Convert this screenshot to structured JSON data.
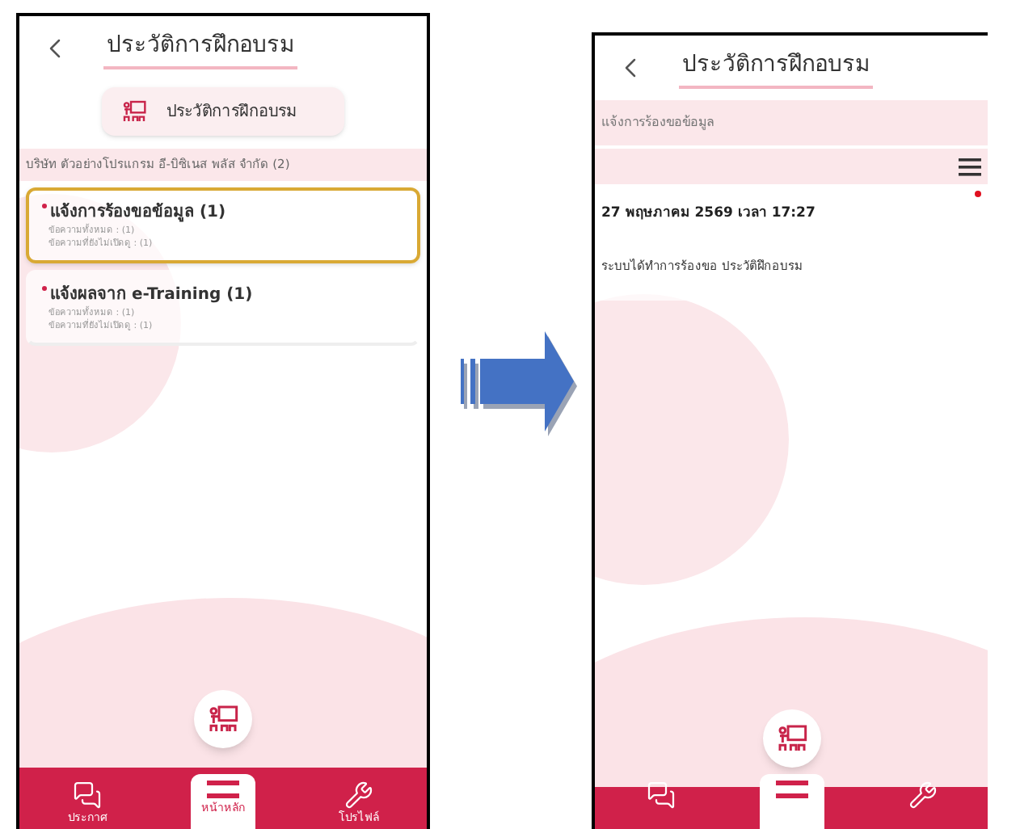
{
  "left_screen": {
    "title": "ประวัติการฝึกอบรม",
    "tab_button": {
      "label": "ประวัติการฝึกอบรม"
    },
    "group": {
      "label": "บริษัท ตัวอย่างโปรแกรม อี-บิซิเนส พลัส จำกัด (2)"
    },
    "items": [
      {
        "title": "แจ้งการร้องขอข้อมูล (1)",
        "lines": [
          "ข้อความทั้งหมด : (1)",
          "ข้อความที่ยังไม่เปิดดู : (1)"
        ],
        "selected": true,
        "unread": true
      },
      {
        "title": "แจ้งผลจาก e-Training (1)",
        "lines": [
          "ข้อความทั้งหมด : (1)",
          "ข้อความที่ยังไม่เปิดดู : (1)"
        ],
        "selected": false,
        "unread": true
      }
    ],
    "nav": [
      {
        "kind": "chat",
        "label": "ประกาศ",
        "selected": false
      },
      {
        "kind": "home",
        "label": "หน้าหลัก",
        "selected": true
      },
      {
        "kind": "profile",
        "label": "โปรไฟล์",
        "selected": false
      }
    ]
  },
  "right_screen": {
    "title": "ประวัติการฝึกอบรม",
    "section": "แจ้งการร้องขอข้อมูล",
    "messages": [
      {
        "date": "27 พฤษภาคม 2569 เวลา 17:27",
        "text": "ระบบได้ทำการร้องขอ ประวัติฝึกอบรม",
        "unread": true
      }
    ],
    "nav": [
      {
        "kind": "chat",
        "selected": false
      },
      {
        "kind": "home",
        "selected": true
      },
      {
        "kind": "profile",
        "selected": false
      }
    ]
  }
}
